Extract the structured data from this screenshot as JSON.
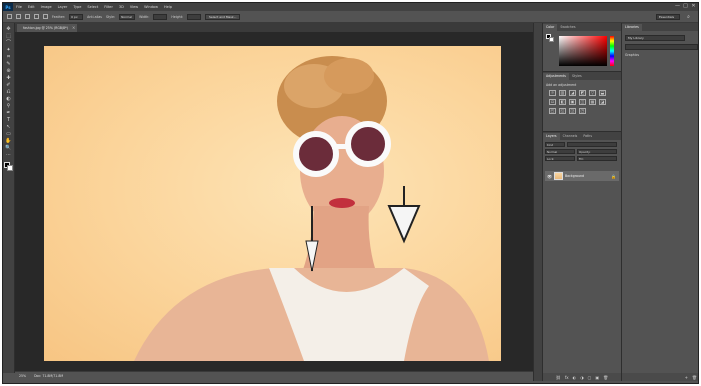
{
  "app": {
    "logo": "Ps"
  },
  "menu": [
    "File",
    "Edit",
    "Image",
    "Layer",
    "Type",
    "Select",
    "Filter",
    "3D",
    "View",
    "Window",
    "Help"
  ],
  "window_controls": [
    "—",
    "□",
    "✕"
  ],
  "options": {
    "feather_label": "Feather:",
    "feather_value": "0 px",
    "antialias_label": "Anti-alias",
    "style_label": "Style:",
    "style_value": "Normal",
    "width_label": "Width:",
    "height_label": "Height:",
    "select_mask_button": "Select and Mask...",
    "workspace": "Essentials"
  },
  "tools": [
    "✥",
    "⬚",
    "⌒",
    "✦",
    "⌗",
    "✎",
    "⊕",
    "✚",
    "✐",
    "⎌",
    "◐",
    "⚲",
    "✒",
    "T",
    "↖",
    "▭",
    "✋",
    "🔍",
    "⋯"
  ],
  "document": {
    "tab_label": "fashion.jpg @ 25% (RGB/8*)",
    "close": "×",
    "status_zoom": "25%",
    "status_doc": "Doc: 71.8M/71.8M"
  },
  "color_panel": {
    "tabs": [
      "Color",
      "Swatches"
    ]
  },
  "adjustments_panel": {
    "tabs": [
      "Adjustments",
      "Styles"
    ],
    "title": "Add an adjustment",
    "icons": [
      "☼",
      "▥",
      "◢",
      "◩",
      "▽",
      "⬓",
      "⚖",
      "◧",
      "▣",
      "◫",
      "▦",
      "◪",
      "◰",
      "◱",
      "◲",
      "◳"
    ]
  },
  "layers_panel": {
    "tabs": [
      "Layers",
      "Channels",
      "Paths"
    ],
    "kind_filter": "Kind",
    "blend_mode": "Normal",
    "opacity": "Opacity:",
    "lock_label": "Lock:",
    "fill_label": "Fill:",
    "layer_name": "Background",
    "bottom_icons": [
      "⛓",
      "fx",
      "◐",
      "◑",
      "▢",
      "▣",
      "🗑"
    ]
  },
  "libraries_panel": {
    "tabs": [
      "Libraries"
    ],
    "library": "My Library",
    "search_placeholder": "",
    "graphics_label": "Graphics"
  },
  "colors": {
    "ui_dark": "#424242",
    "ui_mid": "#535353",
    "canvas_bg": "#282828",
    "image_bg": "#fbd49a"
  }
}
